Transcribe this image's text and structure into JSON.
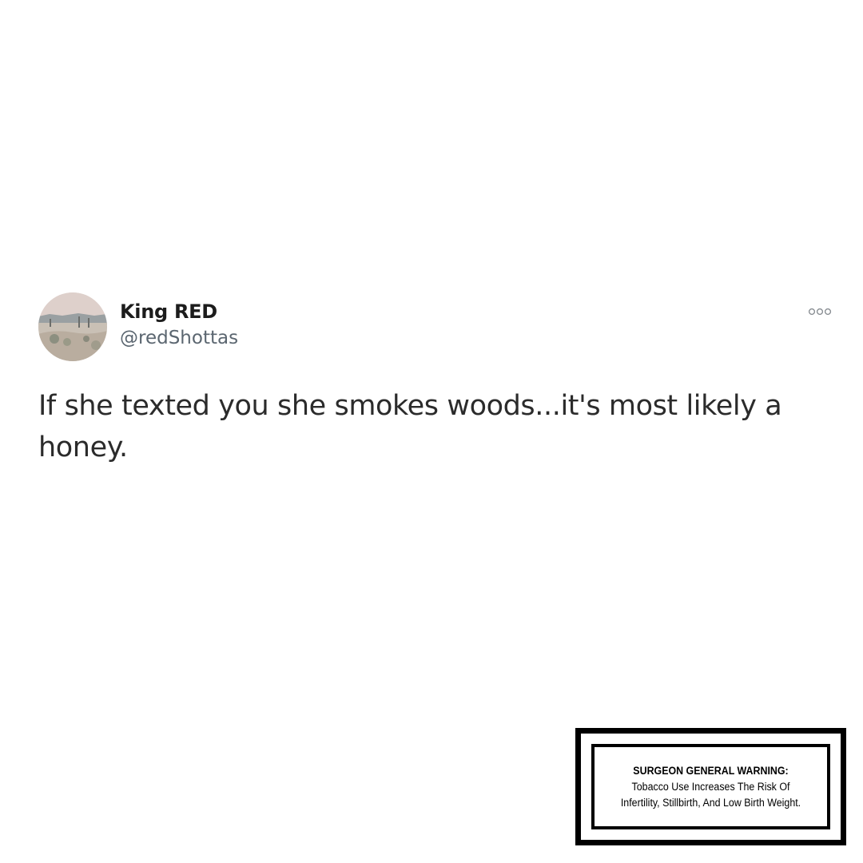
{
  "tweet": {
    "avatar_icon": "desert-landscape-photo",
    "name": "King RED",
    "handle": "@redShottas",
    "more_icon": "more-options-icon",
    "text": "If she texted you she smokes woods...it's most likely a honey."
  },
  "warning": {
    "heading": "SURGEON GENERAL WARNING:",
    "body": " Tobacco Use Increases The Risk Of Infertility, Stillbirth, And Low Birth Weight."
  }
}
